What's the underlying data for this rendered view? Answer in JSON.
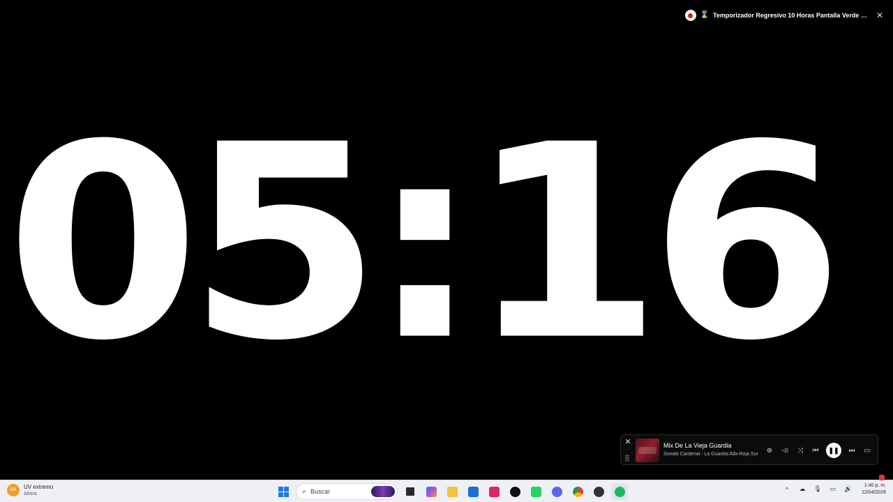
{
  "video": {
    "hourglass": "⌛",
    "title": "Temporizador Regresivo 10 Horas Pantalla Verde | Estilo Ro...",
    "close": "✕"
  },
  "countdown": {
    "time": "05:16"
  },
  "media": {
    "close": "✕",
    "track": "Mix De La Vieja Guardia",
    "artist": "Sonido Cardenal - La Guardia Albi-Roja Sur",
    "icons": {
      "add": "⊕",
      "audio": "◁))",
      "shuffle": "⤨",
      "prev": "⏮",
      "pause": "❚❚",
      "next": "⏭",
      "cast": "▭"
    }
  },
  "taskbar": {
    "weather_badge": "UV",
    "weather_title": "UV extremo",
    "weather_sub": "Ahora",
    "search_placeholder": "Buscar",
    "search_icon": "⌕",
    "clock_time": "1:40 p. m.",
    "clock_date": "12/04/2026",
    "tray_icons": [
      "^",
      "☁",
      "🎙",
      "▭",
      "🔊"
    ]
  },
  "colors": {
    "accent_red": "#d0201a",
    "windows_blue": "#1f7be3",
    "spotify_green": "#1db954"
  }
}
